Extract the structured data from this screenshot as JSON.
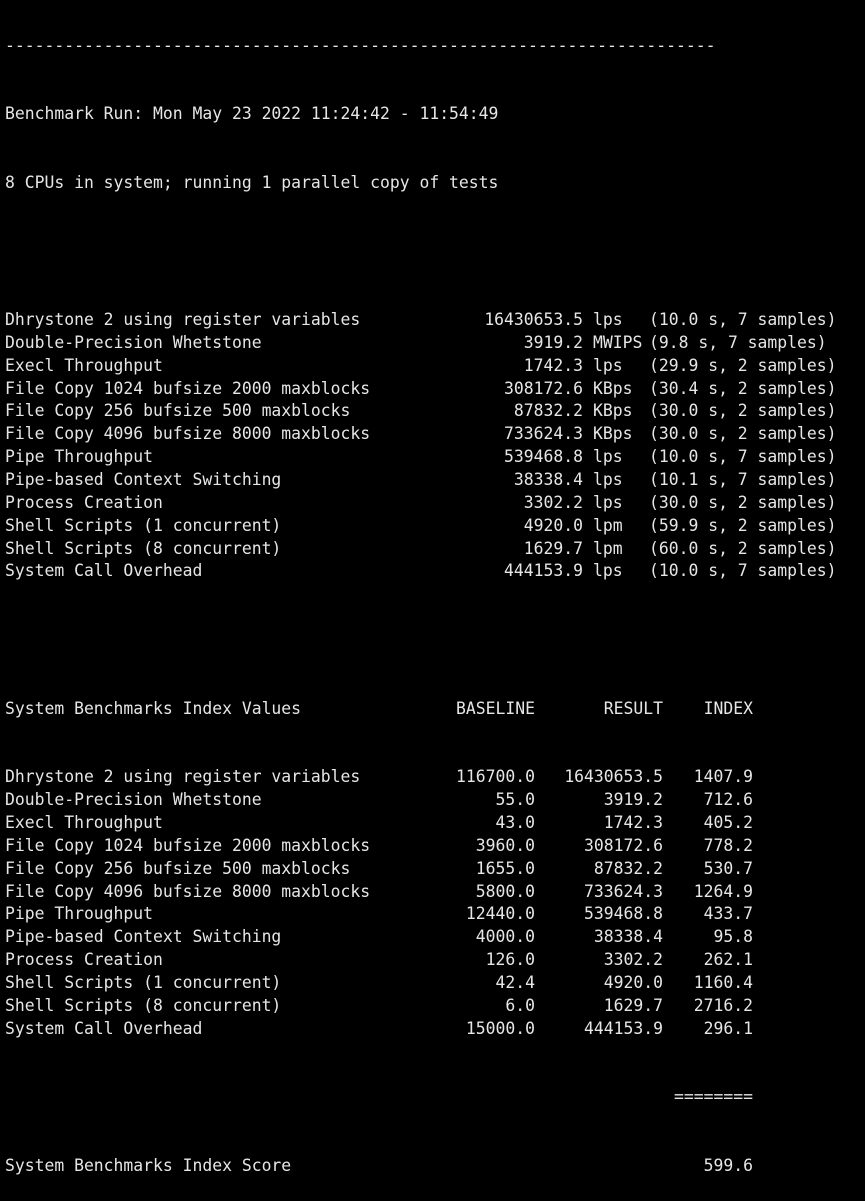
{
  "header": {
    "separator": "------------------------------------------------------------------------",
    "run_line": "Benchmark Run: Mon May 23 2022 11:24:42 - 11:54:49",
    "cpu_line": "8 CPUs in system; running 1 parallel copy of tests"
  },
  "results": [
    {
      "name": "Dhrystone 2 using register variables",
      "value": "16430653.5",
      "unit": "lps",
      "detail": "(10.0 s, 7 samples)"
    },
    {
      "name": "Double-Precision Whetstone",
      "value": "3919.2",
      "unit": "MWIPS",
      "detail": "(9.8 s, 7 samples)"
    },
    {
      "name": "Execl Throughput",
      "value": "1742.3",
      "unit": "lps",
      "detail": "(29.9 s, 2 samples)"
    },
    {
      "name": "File Copy 1024 bufsize 2000 maxblocks",
      "value": "308172.6",
      "unit": "KBps",
      "detail": "(30.4 s, 2 samples)"
    },
    {
      "name": "File Copy 256 bufsize 500 maxblocks",
      "value": "87832.2",
      "unit": "KBps",
      "detail": "(30.0 s, 2 samples)"
    },
    {
      "name": "File Copy 4096 bufsize 8000 maxblocks",
      "value": "733624.3",
      "unit": "KBps",
      "detail": "(30.0 s, 2 samples)"
    },
    {
      "name": "Pipe Throughput",
      "value": "539468.8",
      "unit": "lps",
      "detail": "(10.0 s, 7 samples)"
    },
    {
      "name": "Pipe-based Context Switching",
      "value": "38338.4",
      "unit": "lps",
      "detail": "(10.1 s, 7 samples)"
    },
    {
      "name": "Process Creation",
      "value": "3302.2",
      "unit": "lps",
      "detail": "(30.0 s, 2 samples)"
    },
    {
      "name": "Shell Scripts (1 concurrent)",
      "value": "4920.0",
      "unit": "lpm",
      "detail": "(59.9 s, 2 samples)"
    },
    {
      "name": "Shell Scripts (8 concurrent)",
      "value": "1629.7",
      "unit": "lpm",
      "detail": "(60.0 s, 2 samples)"
    },
    {
      "name": "System Call Overhead",
      "value": "444153.9",
      "unit": "lps",
      "detail": "(10.0 s, 7 samples)"
    }
  ],
  "index_table": {
    "title": "System Benchmarks Index Values",
    "col_baseline": "BASELINE",
    "col_result": "RESULT",
    "col_index": "INDEX",
    "rows": [
      {
        "name": "Dhrystone 2 using register variables",
        "baseline": "116700.0",
        "result": "16430653.5",
        "index": "1407.9"
      },
      {
        "name": "Double-Precision Whetstone",
        "baseline": "55.0",
        "result": "3919.2",
        "index": "712.6"
      },
      {
        "name": "Execl Throughput",
        "baseline": "43.0",
        "result": "1742.3",
        "index": "405.2"
      },
      {
        "name": "File Copy 1024 bufsize 2000 maxblocks",
        "baseline": "3960.0",
        "result": "308172.6",
        "index": "778.2"
      },
      {
        "name": "File Copy 256 bufsize 500 maxblocks",
        "baseline": "1655.0",
        "result": "87832.2",
        "index": "530.7"
      },
      {
        "name": "File Copy 4096 bufsize 8000 maxblocks",
        "baseline": "5800.0",
        "result": "733624.3",
        "index": "1264.9"
      },
      {
        "name": "Pipe Throughput",
        "baseline": "12440.0",
        "result": "539468.8",
        "index": "433.7"
      },
      {
        "name": "Pipe-based Context Switching",
        "baseline": "4000.0",
        "result": "38338.4",
        "index": "95.8"
      },
      {
        "name": "Process Creation",
        "baseline": "126.0",
        "result": "3302.2",
        "index": "262.1"
      },
      {
        "name": "Shell Scripts (1 concurrent)",
        "baseline": "42.4",
        "result": "4920.0",
        "index": "1160.4"
      },
      {
        "name": "Shell Scripts (8 concurrent)",
        "baseline": "6.0",
        "result": "1629.7",
        "index": "2716.2"
      },
      {
        "name": "System Call Overhead",
        "baseline": "15000.0",
        "result": "444153.9",
        "index": "296.1"
      }
    ],
    "rule": "========",
    "score_label": "System Benchmarks Index Score",
    "score_value": "599.6"
  },
  "colors": {
    "background": "#000000",
    "text": "#e6e6e6"
  }
}
